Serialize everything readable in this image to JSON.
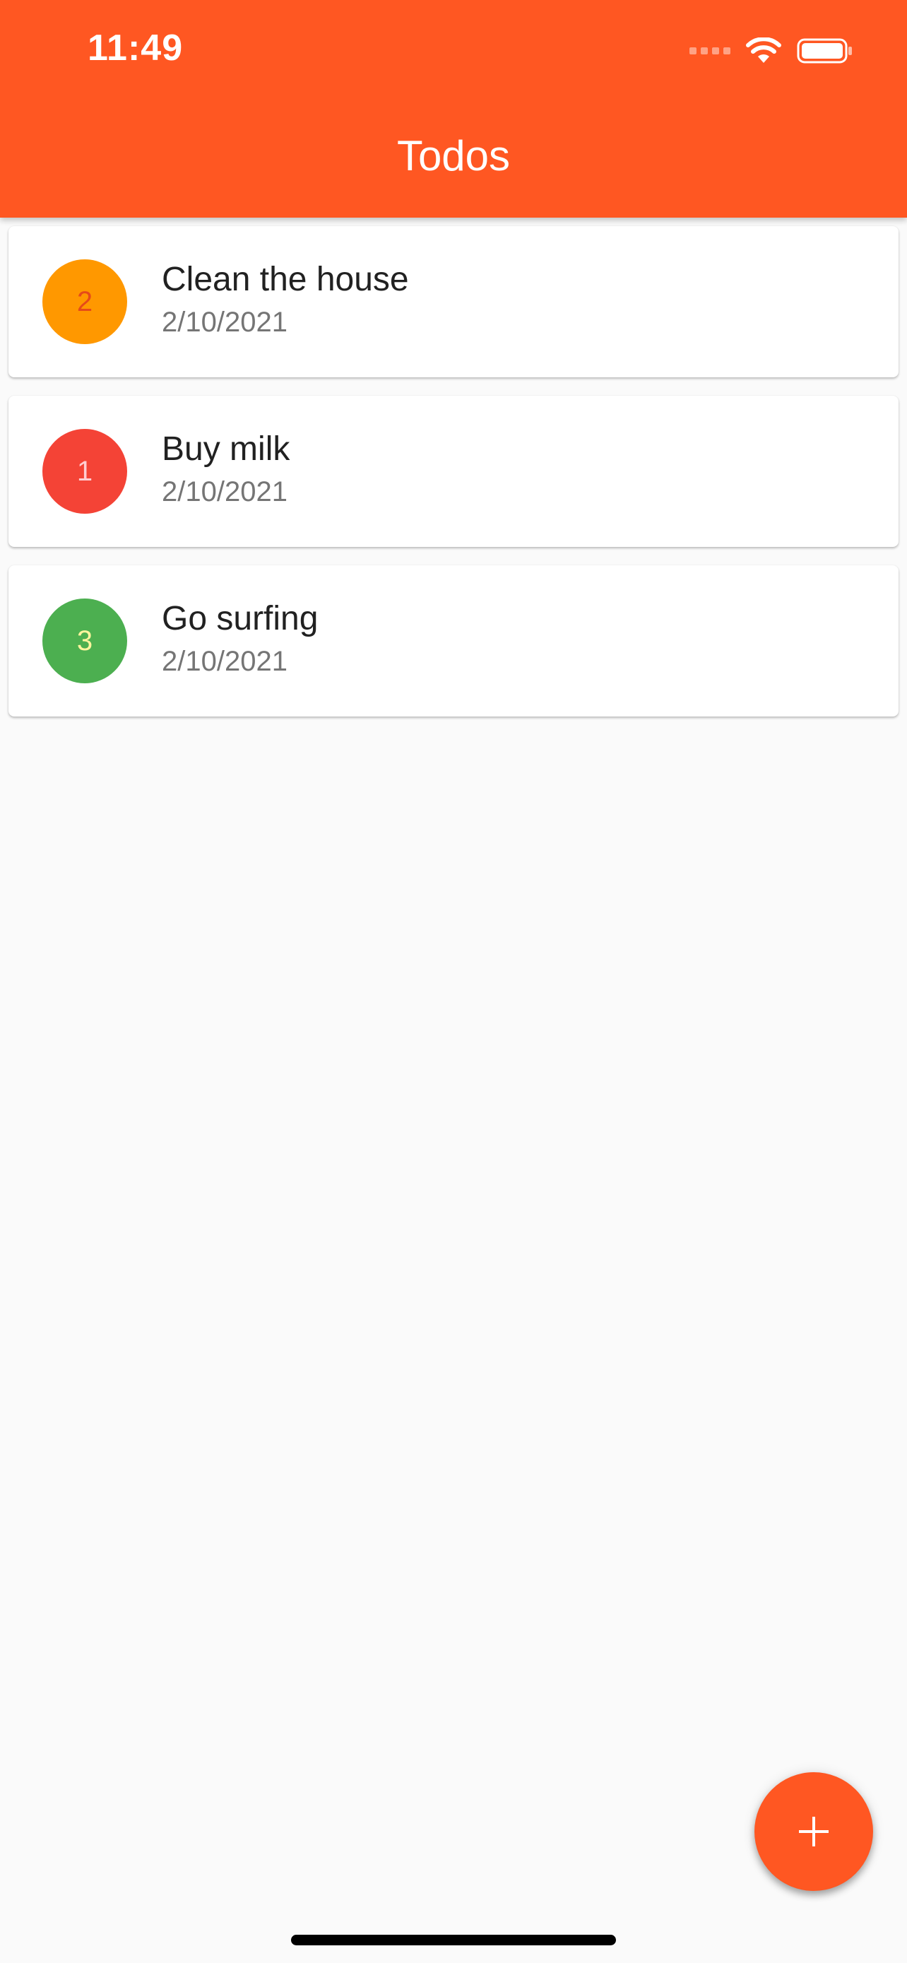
{
  "status_bar": {
    "time": "11:49",
    "icons": [
      "signal-icon",
      "wifi-icon",
      "battery-icon"
    ]
  },
  "app_bar": {
    "title": "Todos",
    "color": "#ff5722"
  },
  "todos": [
    {
      "priority": "2",
      "title": "Clean the house",
      "date": "2/10/2021",
      "avatar_color": "#ff9800",
      "avatar_text_color": "#e64a19"
    },
    {
      "priority": "1",
      "title": "Buy milk",
      "date": "2/10/2021",
      "avatar_color": "#f44336",
      "avatar_text_color": "#ffcdd2"
    },
    {
      "priority": "3",
      "title": "Go surfing",
      "date": "2/10/2021",
      "avatar_color": "#4caf50",
      "avatar_text_color": "#fff59d"
    }
  ],
  "fab": {
    "icon": "plus-icon",
    "color": "#ff5722"
  }
}
